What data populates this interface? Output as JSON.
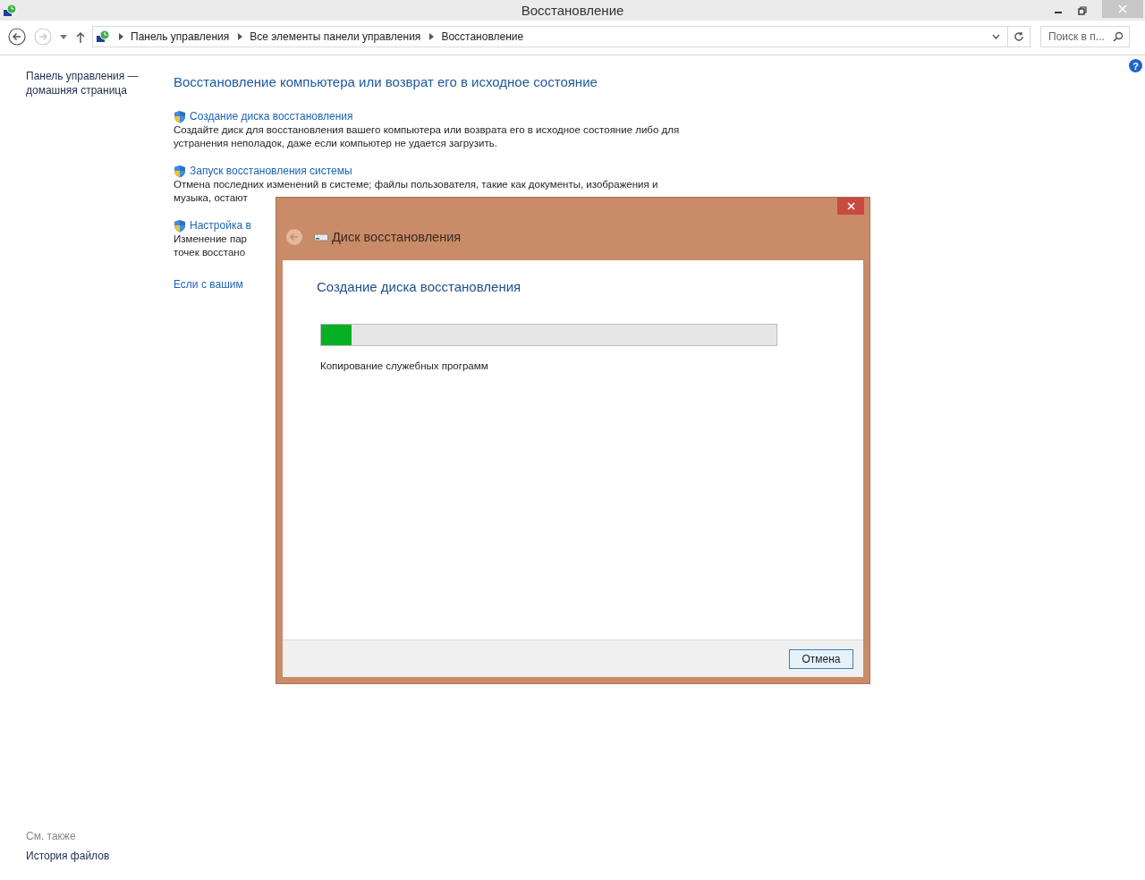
{
  "window": {
    "title": "Восстановление"
  },
  "nav": {
    "back_disabled": false,
    "forward_disabled": true
  },
  "breadcrumb": [
    "Панель управления",
    "Все элементы панели управления",
    "Восстановление"
  ],
  "search": {
    "placeholder": "Поиск в п..."
  },
  "help": {
    "glyph": "?"
  },
  "sidebar": {
    "home_link": "Панель управления — домашняя страница",
    "see_also_label": "См. также",
    "see_also_links": [
      "История файлов"
    ]
  },
  "main": {
    "heading": "Восстановление компьютера или возврат его в исходное состояние",
    "items": [
      {
        "link": "Создание диска восстановления",
        "lines": [
          "Создайте диск для восстановления вашего компьютера или возврата его в исходное состояние либо для",
          "устранения неполадок, даже если компьютер не удается загрузить."
        ]
      },
      {
        "link": "Запуск восстановления системы",
        "lines": [
          "Отмена последних изменений в системе; файлы пользователя, такие как документы, изображения и",
          "музыка, остают"
        ]
      },
      {
        "link": "Настройка в",
        "lines": [
          "Изменение пар",
          "точек восстано"
        ]
      }
    ],
    "footer_link": "Если с вашим"
  },
  "dialog": {
    "title": "Диск восстановления",
    "heading": "Создание диска восстановления",
    "progress": {
      "level": 0.067
    },
    "status": "Копирование служебных программ",
    "buttons": [
      "Отмена"
    ]
  }
}
